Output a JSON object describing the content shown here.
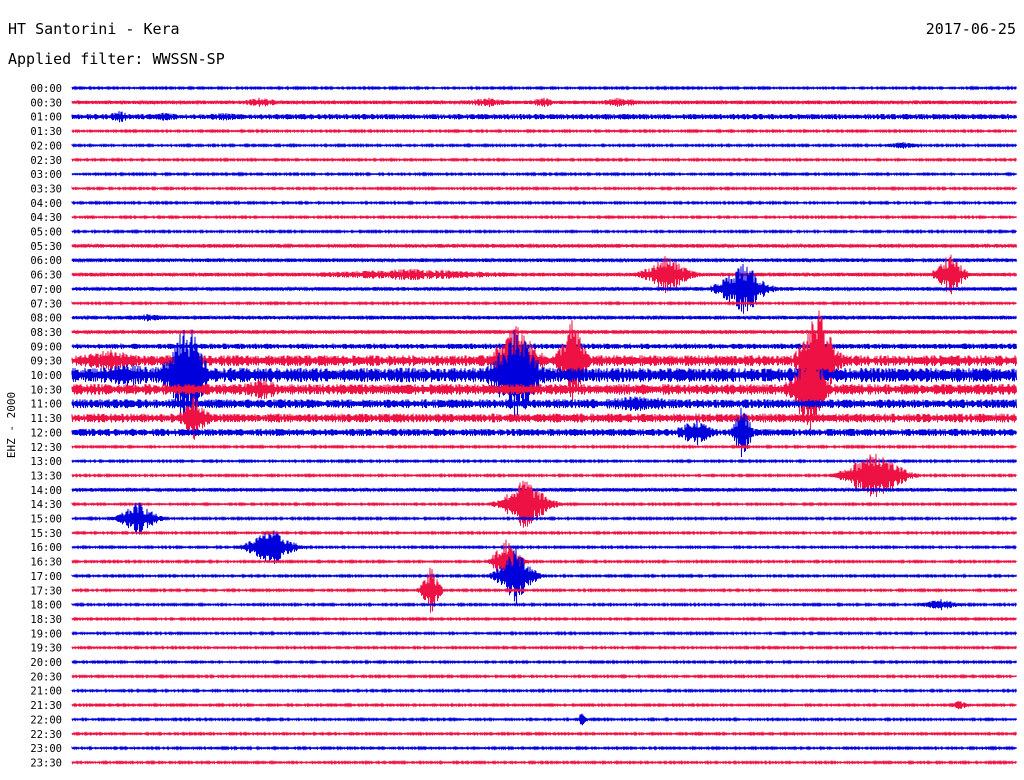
{
  "header": {
    "station": "HT Santorini - Kera",
    "filter": "Applied filter: WWSSN-SP",
    "date": "2017-06-25"
  },
  "chart_data": {
    "type": "line",
    "title": "HT Santorini - Kera",
    "subtitle": "Applied filter: WWSSN-SP",
    "date": "2017-06-25",
    "ylabel": "EHZ - 2000",
    "trace_colors": [
      "#0000dd",
      "#ee1144"
    ],
    "rows": [
      "00:00",
      "00:30",
      "01:00",
      "01:30",
      "02:00",
      "02:30",
      "03:00",
      "03:30",
      "04:00",
      "04:30",
      "05:00",
      "05:30",
      "06:00",
      "06:30",
      "07:00",
      "07:30",
      "08:00",
      "08:30",
      "09:00",
      "09:30",
      "10:00",
      "10:30",
      "11:00",
      "11:30",
      "12:00",
      "12:30",
      "13:00",
      "13:30",
      "14:00",
      "14:30",
      "15:00",
      "15:30",
      "16:00",
      "16:30",
      "17:00",
      "17:30",
      "18:00",
      "18:30",
      "19:00",
      "19:30",
      "20:00",
      "20:30",
      "21:00",
      "21:30",
      "22:00",
      "22:30",
      "23:00",
      "23:30"
    ],
    "background_amplitude": [
      1,
      2,
      3,
      1,
      1,
      1,
      1,
      1,
      1,
      1,
      1,
      2,
      2,
      2,
      2,
      1,
      2,
      2,
      3,
      6,
      8,
      6,
      5,
      5,
      4,
      1,
      1,
      1,
      2,
      1,
      1,
      1,
      1,
      1,
      1,
      1,
      1,
      1,
      1,
      1,
      1,
      1,
      1,
      1,
      1,
      1,
      1,
      1
    ],
    "bursts": [
      [
        1,
        0.2,
        0.05,
        5
      ],
      [
        1,
        0.44,
        0.06,
        5
      ],
      [
        1,
        0.5,
        0.04,
        5
      ],
      [
        1,
        0.58,
        0.06,
        5
      ],
      [
        2,
        0.05,
        0.04,
        6
      ],
      [
        2,
        0.1,
        0.05,
        5
      ],
      [
        2,
        0.16,
        0.08,
        4
      ],
      [
        4,
        0.88,
        0.04,
        4
      ],
      [
        13,
        0.36,
        0.25,
        6
      ],
      [
        13,
        0.63,
        0.05,
        20
      ],
      [
        13,
        0.93,
        0.03,
        25
      ],
      [
        14,
        0.71,
        0.05,
        28
      ],
      [
        14,
        0.72,
        0.03,
        20
      ],
      [
        16,
        0.08,
        0.06,
        4
      ],
      [
        19,
        0.04,
        0.09,
        12
      ],
      [
        19,
        0.47,
        0.05,
        40
      ],
      [
        19,
        0.53,
        0.03,
        45
      ],
      [
        19,
        0.79,
        0.04,
        55
      ],
      [
        20,
        0.06,
        0.15,
        12
      ],
      [
        20,
        0.12,
        0.04,
        70
      ],
      [
        20,
        0.47,
        0.05,
        55
      ],
      [
        21,
        0.2,
        0.06,
        12
      ],
      [
        21,
        0.78,
        0.04,
        45
      ],
      [
        22,
        0.6,
        0.15,
        8
      ],
      [
        23,
        0.13,
        0.03,
        25
      ],
      [
        24,
        0.66,
        0.04,
        16
      ],
      [
        24,
        0.71,
        0.02,
        30
      ],
      [
        27,
        0.85,
        0.06,
        30
      ],
      [
        29,
        0.48,
        0.05,
        28
      ],
      [
        30,
        0.07,
        0.04,
        18
      ],
      [
        32,
        0.21,
        0.05,
        20
      ],
      [
        33,
        0.46,
        0.03,
        25
      ],
      [
        34,
        0.47,
        0.04,
        30
      ],
      [
        35,
        0.38,
        0.02,
        25
      ],
      [
        36,
        0.92,
        0.04,
        6
      ],
      [
        43,
        0.94,
        0.02,
        5
      ],
      [
        44,
        0.54,
        0.01,
        8
      ]
    ]
  }
}
